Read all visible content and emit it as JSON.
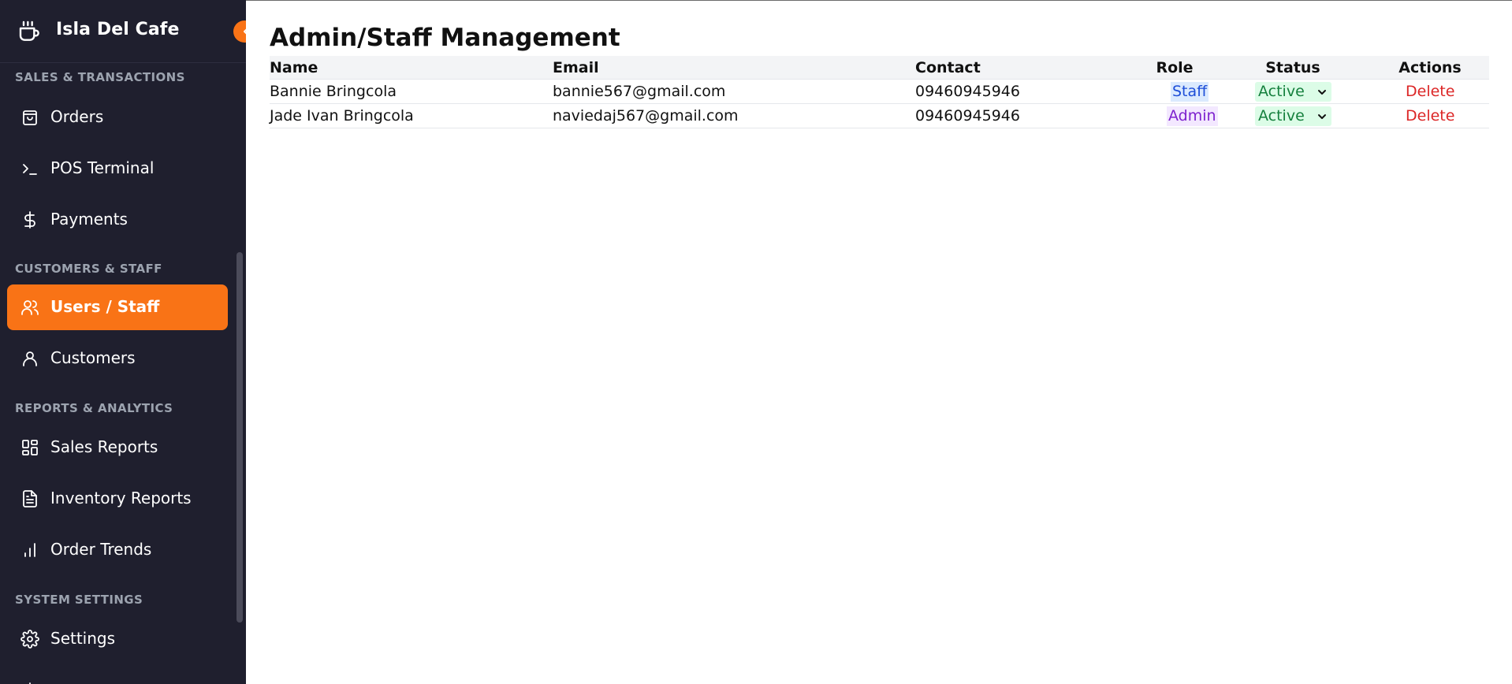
{
  "app": {
    "name": "Isla Del Cafe"
  },
  "sidebar": {
    "sections": [
      {
        "title": "SALES & TRANSACTIONS"
      },
      {
        "title": "CUSTOMERS & STAFF"
      },
      {
        "title": "REPORTS & ANALYTICS"
      },
      {
        "title": "SYSTEM SETTINGS"
      }
    ],
    "items": [
      {
        "label": "Orders",
        "icon": "shopping-bag-icon"
      },
      {
        "label": "POS Terminal",
        "icon": "terminal-icon"
      },
      {
        "label": "Payments",
        "icon": "dollar-icon"
      },
      {
        "label": "Users / Staff",
        "icon": "users-icon",
        "active": true
      },
      {
        "label": "Customers",
        "icon": "user-icon"
      },
      {
        "label": "Sales Reports",
        "icon": "dashboard-icon"
      },
      {
        "label": "Inventory Reports",
        "icon": "document-icon"
      },
      {
        "label": "Order Trends",
        "icon": "bar-chart-icon"
      },
      {
        "label": "Settings",
        "icon": "gear-icon"
      }
    ],
    "accent_color": "#f97316",
    "background_color": "#1f1f2e"
  },
  "page": {
    "title": "Admin/Staff Management"
  },
  "table": {
    "headers": {
      "name": "Name",
      "email": "Email",
      "contact": "Contact",
      "role": "Role",
      "status": "Status",
      "actions": "Actions"
    },
    "rows": [
      {
        "name": "Bannie Bringcola",
        "email": "bannie567@gmail.com",
        "contact": "09460945946",
        "role": "Staff",
        "status": "Active",
        "action": "Delete"
      },
      {
        "name": "Jade Ivan Bringcola",
        "email": "naviedaj567@gmail.com",
        "contact": "09460945946",
        "role": "Admin",
        "status": "Active",
        "action": "Delete"
      }
    ]
  },
  "colors": {
    "role_staff_bg": "#dbeafe",
    "role_admin_bg": "#f3e8ff",
    "status_active_bg": "#dcfce7",
    "delete_text": "#dc2626"
  }
}
